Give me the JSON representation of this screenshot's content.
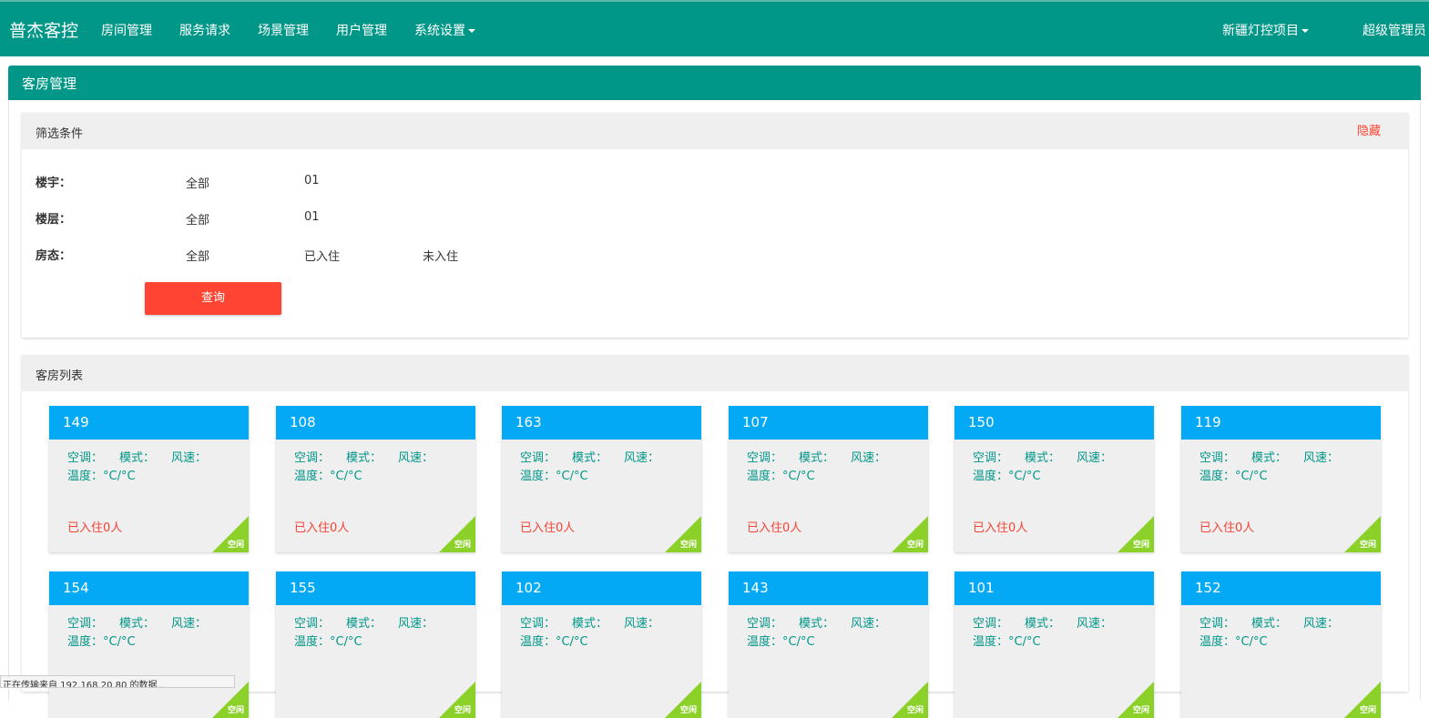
{
  "nav": {
    "brand": "普杰客控",
    "items": [
      "房间管理",
      "服务请求",
      "场景管理",
      "用户管理",
      "系统设置"
    ],
    "project": "新疆灯控项目",
    "user": "超级管理员"
  },
  "page": {
    "title": "客房管理"
  },
  "filter": {
    "title": "筛选条件",
    "hide": "隐藏",
    "building": {
      "label": "楼宇：",
      "options": [
        "全部",
        "01"
      ]
    },
    "floor": {
      "label": "楼层：",
      "options": [
        "全部",
        "01"
      ]
    },
    "status": {
      "label": "房态：",
      "options": [
        "全部",
        "已入住",
        "未入住"
      ]
    },
    "query_button": "查询"
  },
  "room_list": {
    "title": "客房列表",
    "labels": {
      "ac": "空调：",
      "mode": "模式：",
      "fan": "风速：",
      "temp": "温度：°C/°C",
      "badge": "空闲"
    },
    "rooms": [
      {
        "number": "149",
        "occupancy": "已入住0人"
      },
      {
        "number": "108",
        "occupancy": "已入住0人"
      },
      {
        "number": "163",
        "occupancy": "已入住0人"
      },
      {
        "number": "107",
        "occupancy": "已入住0人"
      },
      {
        "number": "150",
        "occupancy": "已入住0人"
      },
      {
        "number": "119",
        "occupancy": "已入住0人"
      },
      {
        "number": "154",
        "occupancy": ""
      },
      {
        "number": "155",
        "occupancy": ""
      },
      {
        "number": "102",
        "occupancy": ""
      },
      {
        "number": "143",
        "occupancy": ""
      },
      {
        "number": "101",
        "occupancy": ""
      },
      {
        "number": "152",
        "occupancy": ""
      }
    ]
  },
  "status_bar": "正在传输来自 192.168.20.80 的数据...",
  "colors": {
    "primary": "#009688",
    "card_header": "#03a9f4",
    "danger": "#ff4433",
    "badge": "#8bd12a"
  }
}
